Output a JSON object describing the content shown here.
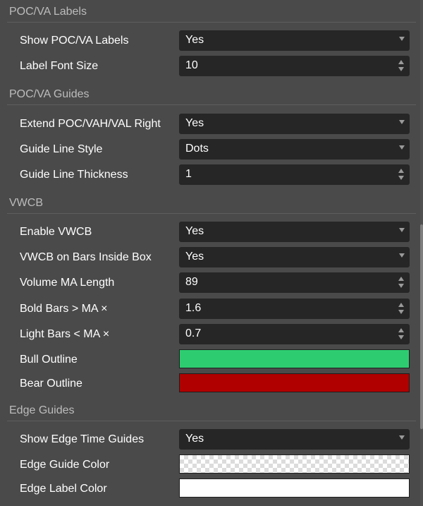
{
  "sections": [
    {
      "title": "POC/VA Labels",
      "rows": [
        {
          "label": "Show POC/VA Labels",
          "type": "select",
          "value": "Yes"
        },
        {
          "label": "Label Font Size",
          "type": "number",
          "value": "10"
        }
      ]
    },
    {
      "title": "POC/VA Guides",
      "rows": [
        {
          "label": "Extend POC/VAH/VAL Right",
          "type": "select",
          "value": "Yes"
        },
        {
          "label": "Guide Line Style",
          "type": "select",
          "value": "Dots"
        },
        {
          "label": "Guide Line Thickness",
          "type": "number",
          "value": "1"
        }
      ]
    },
    {
      "title": "VWCB",
      "rows": [
        {
          "label": "Enable VWCB",
          "type": "select",
          "value": "Yes"
        },
        {
          "label": "VWCB on Bars Inside Box",
          "type": "select",
          "value": "Yes"
        },
        {
          "label": "Volume MA Length",
          "type": "number",
          "value": "89"
        },
        {
          "label": "Bold Bars > MA ×",
          "type": "number",
          "value": "1.6"
        },
        {
          "label": "Light Bars < MA ×",
          "type": "number",
          "value": "0.7"
        },
        {
          "label": "Bull Outline",
          "type": "color",
          "value": "#2ecc71"
        },
        {
          "label": "Bear Outline",
          "type": "color",
          "value": "#b00000"
        }
      ]
    },
    {
      "title": "Edge Guides",
      "rows": [
        {
          "label": "Show Edge Time Guides",
          "type": "select",
          "value": "Yes"
        },
        {
          "label": "Edge Guide Color",
          "type": "color",
          "value": "transparent"
        },
        {
          "label": "Edge Label Color",
          "type": "color",
          "value": "#ffffff"
        }
      ]
    }
  ]
}
